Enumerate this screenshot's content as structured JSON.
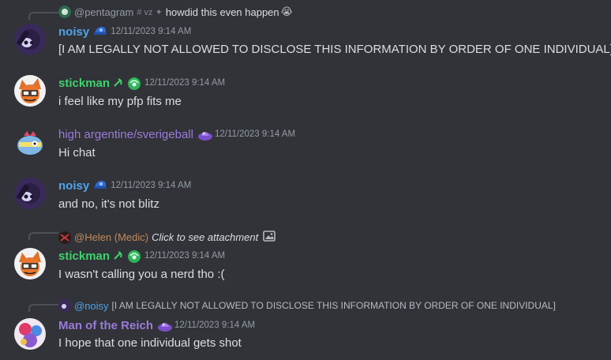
{
  "messages": [
    {
      "reply": {
        "username": "@pentagram",
        "channel_tag": "# vz ✦",
        "text": "howdid this even happen",
        "emoji": "😭"
      },
      "username": "noisy",
      "username_color": "#4ea3e8",
      "timestamp": "12/11/2023 9:14 AM",
      "content": "[I AM LEGALLY NOT ALLOWED TO DISCLOSE THIS INFORMATION BY ORDER OF ONE INDIVIDUAL]"
    },
    {
      "username": "stickman",
      "username_color": "#3fd26b",
      "timestamp": "12/11/2023 9:14 AM",
      "content": "i feel like my pfp fits me"
    },
    {
      "username": "high argentine/sverigeball",
      "username_color": "#9b7bd8",
      "timestamp": "12/11/2023 9:14 AM",
      "content": "Hi chat"
    },
    {
      "username": "noisy",
      "username_color": "#4ea3e8",
      "timestamp": "12/11/2023 9:14 AM",
      "content": "and no, it's not blitz"
    },
    {
      "reply": {
        "username": "@Helen (Medic)",
        "text": "Click to see attachment"
      },
      "username": "stickman",
      "username_color": "#3fd26b",
      "timestamp": "12/11/2023 9:14 AM",
      "content": "I wasn't calling you a nerd tho :("
    },
    {
      "reply": {
        "username": "@noisy",
        "text": "[I AM LEGALLY NOT ALLOWED TO DISCLOSE THIS INFORMATION BY ORDER OF ONE INDIVIDUAL]"
      },
      "username": "Man of the Reich",
      "username_color": "#9b7bd8",
      "timestamp": "12/11/2023 9:14 AM",
      "content": "I hope that one individual gets shot"
    }
  ],
  "colors": {
    "background": "#313338",
    "text": "#dbdee1",
    "timestamp": "#949ba4",
    "reply_helen": "#c28a5a",
    "reply_pentagram": "#949ba4"
  }
}
